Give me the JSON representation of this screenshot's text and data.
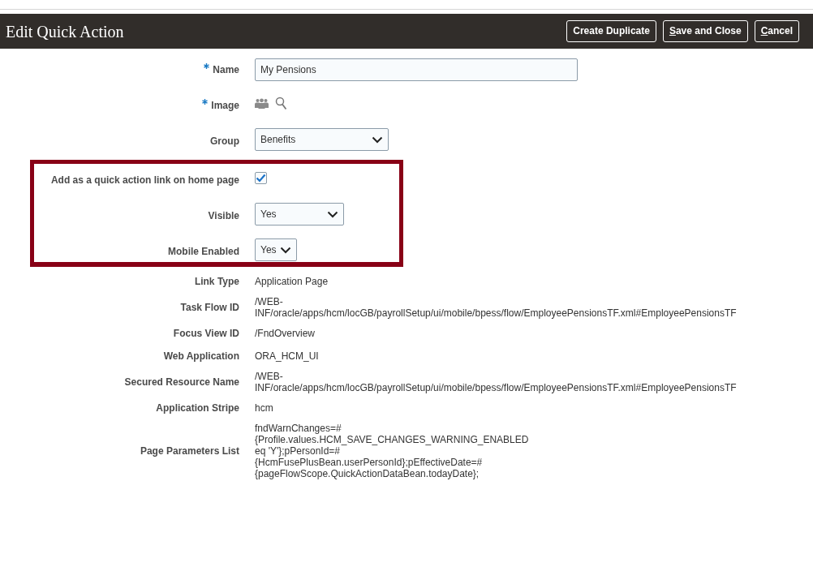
{
  "header": {
    "title": "Edit Quick Action",
    "buttons": [
      {
        "label": "Create Duplicate",
        "mnemonic": false
      },
      {
        "label": "Save and Close",
        "mnemonic": true
      },
      {
        "label": "Cancel",
        "mnemonic": true
      }
    ]
  },
  "fields": [
    {
      "kind": "text",
      "label": "Name",
      "required": true,
      "value": "My Pensions"
    },
    {
      "kind": "image",
      "label": "Image",
      "required": true
    },
    {
      "kind": "select",
      "label": "Group",
      "required": false,
      "value": "Benefits"
    }
  ],
  "highlighted_fields": [
    {
      "kind": "checkbox",
      "label": "Add as a quick action link on home page",
      "required": false,
      "checked": true
    },
    {
      "kind": "select",
      "label": "Visible",
      "required": false,
      "value": "Yes"
    },
    {
      "kind": "select",
      "label": "Mobile Enabled",
      "required": false,
      "value": "Yes"
    }
  ],
  "details": [
    {
      "label": "Link Type",
      "lines": [
        "Application Page"
      ]
    },
    {
      "label": "Task Flow ID",
      "lines": [
        "/WEB-",
        "INF/oracle/apps/hcm/locGB/payrollSetup/ui/mobile/bpess/flow/EmployeePensionsTF.xml#EmployeePensionsTF"
      ]
    },
    {
      "label": "Focus View ID",
      "lines": [
        "/FndOverview"
      ]
    },
    {
      "label": "Web Application",
      "lines": [
        "ORA_HCM_UI"
      ]
    },
    {
      "label": "Secured Resource Name",
      "lines": [
        "/WEB-",
        "INF/oracle/apps/hcm/locGB/payrollSetup/ui/mobile/bpess/flow/EmployeePensionsTF.xml#EmployeePensionsTF"
      ]
    },
    {
      "label": "Application Stripe",
      "lines": [
        "hcm"
      ]
    },
    {
      "label": "Page Parameters List",
      "lines": [
        "fndWarnChanges=#",
        "{Profile.values.HCM_SAVE_CHANGES_WARNING_ENABLED",
        "eq 'Y'};pPersonId=#",
        "{HcmFusePlusBean.userPersonId};pEffectiveDate=#",
        "{pageFlowScope.QuickActionDataBean.todayDate};"
      ]
    }
  ]
}
